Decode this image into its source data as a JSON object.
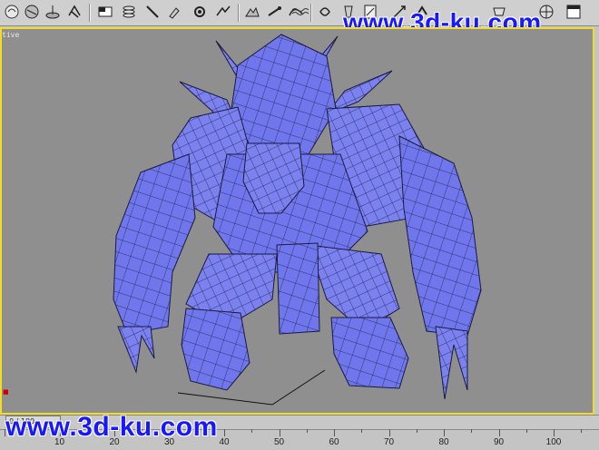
{
  "toolbar": {
    "icons": [
      "select-object-icon",
      "sphere-icon",
      "cylinder-icon",
      "helper-icon",
      "display-icon",
      "layer-icon",
      "line-icon",
      "paint-icon",
      "modifier-icon",
      "utility-icon",
      "terrain-icon",
      "bone-icon",
      "curve-icon",
      "wave-icon",
      "hand-icon",
      "cloth-icon",
      "wand-icon",
      "emitter-icon",
      "teapot-icon",
      "render-icon",
      "environment-icon",
      "window-icon"
    ]
  },
  "viewport": {
    "label": "tive",
    "border_color": "#f2dc28",
    "background": "#8f8f8f",
    "model_color": "#6f76ea"
  },
  "watermark": {
    "top": "www.3d-ku.com",
    "bottom": "www.3d-ku.com",
    "color": "#1818ff"
  },
  "timeline": {
    "frame_counter": "0 / 100",
    "ruler_labels": [
      "10",
      "20",
      "30",
      "40",
      "50",
      "60",
      "70",
      "80",
      "90",
      "100"
    ]
  }
}
